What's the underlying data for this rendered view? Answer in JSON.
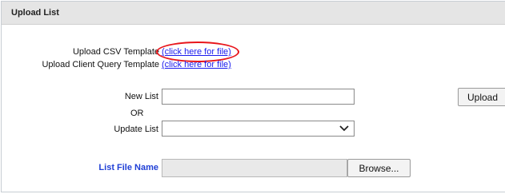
{
  "header": {
    "title": "Upload List"
  },
  "templates": {
    "csv_label": "Upload CSV Template",
    "csv_link": "(click here for file)",
    "query_label": "Upload Client Query Template",
    "query_link": "(click here for file)"
  },
  "form": {
    "new_list_label": "New List",
    "new_list_value": "",
    "or_label": "OR",
    "update_list_label": "Update List",
    "update_list_value": "",
    "upload_button": "Upload",
    "file_name_label": "List File Name",
    "file_name_value": "",
    "browse_button": "Browse..."
  },
  "colors": {
    "highlight": "#e8151b",
    "link": "#1a1aee",
    "label_blue": "#1f3fd6"
  }
}
